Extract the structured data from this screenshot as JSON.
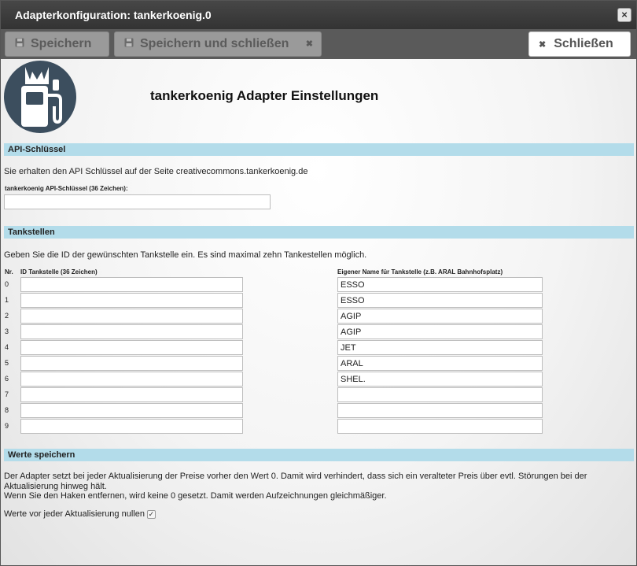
{
  "window": {
    "title": "Adapterkonfiguration: tankerkoenig.0",
    "close_label": "×"
  },
  "toolbar": {
    "save_label": "Speichern",
    "save_close_label": "Speichern und schließen",
    "close_label": "Schließen"
  },
  "page": {
    "heading": "tankerkoenig Adapter Einstellungen"
  },
  "api": {
    "section_title": "API-Schlüssel",
    "info": "Sie erhalten den API Schlüssel auf der Seite creativecommons.tankerkoenig.de",
    "key_label": "tankerkoenig API-Schlüssel (36 Zeichen):",
    "key_value": ""
  },
  "stations": {
    "section_title": "Tankstellen",
    "info": "Geben Sie die ID der gewünschten Tankstelle ein. Es sind maximal zehn Tankestellen möglich.",
    "col_nr": "Nr.",
    "col_id": "ID Tankstelle (36 Zeichen)",
    "col_name": "Eigener Name für Tankstelle (z.B. ARAL Bahnhofsplatz)",
    "rows": [
      {
        "nr": "0",
        "id": "",
        "name": "ESSO"
      },
      {
        "nr": "1",
        "id": "",
        "name": "ESSO"
      },
      {
        "nr": "2",
        "id": "",
        "name": "AGIP"
      },
      {
        "nr": "3",
        "id": "",
        "name": "AGIP"
      },
      {
        "nr": "4",
        "id": "",
        "name": "JET"
      },
      {
        "nr": "5",
        "id": "",
        "name": "ARAL"
      },
      {
        "nr": "6",
        "id": "",
        "name": "SHEL."
      },
      {
        "nr": "7",
        "id": "",
        "name": ""
      },
      {
        "nr": "8",
        "id": "",
        "name": ""
      },
      {
        "nr": "9",
        "id": "",
        "name": ""
      }
    ]
  },
  "reset": {
    "section_title": "Werte speichern",
    "info1": "Der Adapter setzt bei jeder Aktualisierung der Preise vorher den Wert 0. Damit wird verhindert, dass sich ein veralteter Preis über evtl. Störungen bei der Aktualisierung hinweg hält.",
    "info2": "Wenn Sie den Haken entfernen, wird keine 0 gesetzt. Damit werden Aufzeichnungen gleichmäßiger.",
    "checkbox_label": "Werte vor jeder Aktualisierung nullen",
    "checked": true,
    "check_mark": "✓"
  }
}
